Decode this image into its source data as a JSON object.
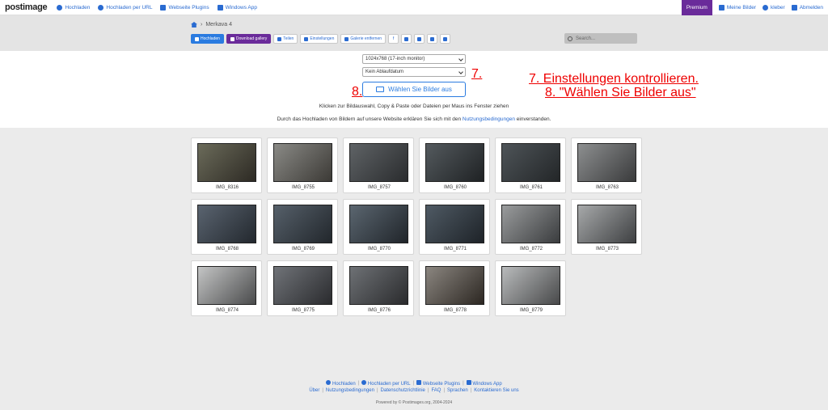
{
  "nav": {
    "logo": "postimage",
    "links": [
      {
        "label": "Hochladen",
        "icon": "cloud-upload-icon"
      },
      {
        "label": "Hochladen per URL",
        "icon": "globe-icon"
      },
      {
        "label": "Webseite Plugins",
        "icon": "puzzle-icon"
      },
      {
        "label": "Windows App",
        "icon": "windows-icon"
      }
    ],
    "premium": "Premium",
    "right_links": [
      {
        "label": "Meine Bilder",
        "icon": "image-icon"
      },
      {
        "label": "kleber",
        "icon": "user-icon"
      },
      {
        "label": "Abmelden",
        "icon": "logout-icon"
      }
    ]
  },
  "breadcrumb": {
    "current": "Merkava 4"
  },
  "toolbar": {
    "upload": "Hochladen",
    "download": "Download gallery",
    "share": "Teilen",
    "settings": "Einstellungen",
    "remove": "Galerie entfernen"
  },
  "search": {
    "placeholder": "Search..."
  },
  "upload": {
    "size_select": "1024x768 (17-inch monitor)",
    "expiry_select": "Kein Ablaufdatum",
    "choose_button": "Wählen Sie Bilder aus",
    "hint": "Klicken zur Bildauswahl, Copy & Paste oder Dateien per Maus ins Fenster ziehen",
    "terms_prefix": "Durch das Hochladen von Bildern auf unsere Website erklären Sie sich mit den",
    "terms_link": "Nutzungsbedingungen",
    "terms_suffix": "einverstanden."
  },
  "annotations": {
    "step7_marker": "7.",
    "step8_marker": "8.",
    "line1": "7. Einstellungen kontrollieren.",
    "line2": "8. \"Wählen Sie Bilder aus\""
  },
  "gallery": [
    {
      "name": "IMG_8316"
    },
    {
      "name": "IMG_8755"
    },
    {
      "name": "IMG_8757"
    },
    {
      "name": "IMG_8760"
    },
    {
      "name": "IMG_8761"
    },
    {
      "name": "IMG_8763"
    },
    {
      "name": "IMG_8768"
    },
    {
      "name": "IMG_8769"
    },
    {
      "name": "IMG_8770"
    },
    {
      "name": "IMG_8771"
    },
    {
      "name": "IMG_8772"
    },
    {
      "name": "IMG_8773"
    },
    {
      "name": "IMG_8774"
    },
    {
      "name": "IMG_8775"
    },
    {
      "name": "IMG_8776"
    },
    {
      "name": "IMG_8778"
    },
    {
      "name": "IMG_8779"
    }
  ],
  "footer": {
    "row1": [
      {
        "label": "Hochladen",
        "icon": "cloud-upload-icon"
      },
      {
        "label": "Hochladen per URL",
        "icon": "globe-icon"
      },
      {
        "label": "Webseite Plugins",
        "icon": "puzzle-icon"
      },
      {
        "label": "Windows App",
        "icon": "windows-icon"
      }
    ],
    "row2": [
      "Über",
      "Nutzungsbedingungen",
      "Datenschutzrichtlinie",
      "FAQ",
      "Sprachen",
      "Kontaktieren Sie uns"
    ],
    "powered": "Powered by © Postimages.org, 2004-2024"
  },
  "colors": {
    "accent": "#2a7be0",
    "premium": "#6a2b9a",
    "annotation": "#e00000"
  }
}
